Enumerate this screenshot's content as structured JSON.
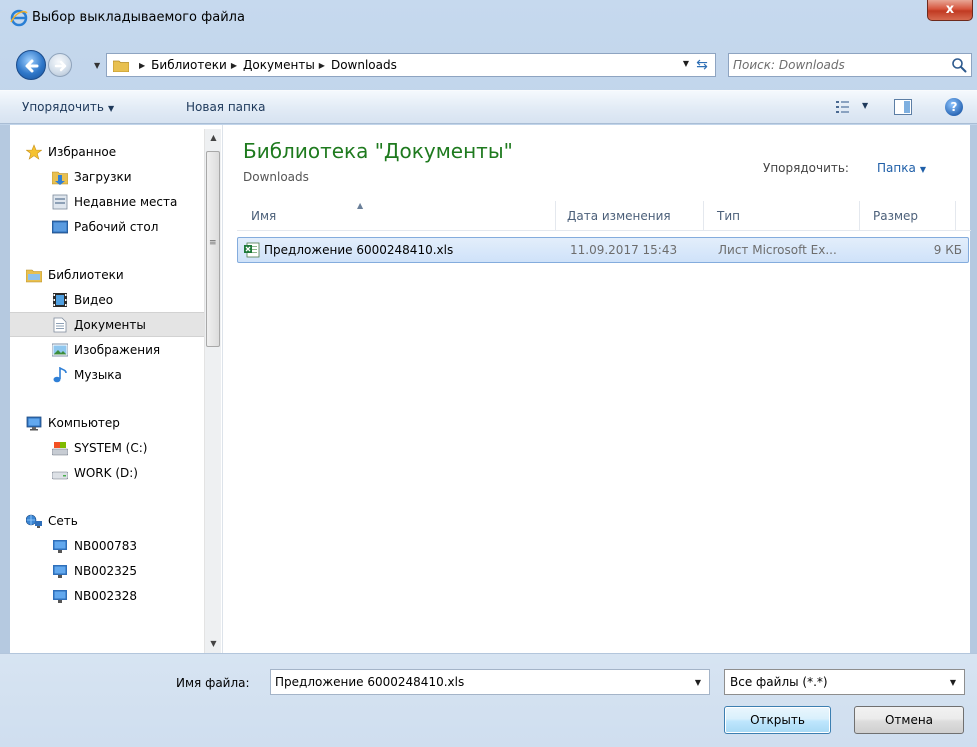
{
  "window": {
    "title": "Выбор выкладываемого файла",
    "close_label": "x"
  },
  "address": {
    "segments": [
      "Библиотеки",
      "Документы",
      "Downloads"
    ],
    "search_placeholder": "Поиск: Downloads"
  },
  "toolbar": {
    "organize_label": "Упорядочить",
    "new_folder_label": "Новая папка",
    "help_label": "?"
  },
  "nav": {
    "favorites": {
      "label": "Избранное",
      "items": [
        "Загрузки",
        "Недавние места",
        "Рабочий стол"
      ]
    },
    "libraries": {
      "label": "Библиотеки",
      "items": [
        "Видео",
        "Документы",
        "Изображения",
        "Музыка"
      ],
      "selected": "Документы"
    },
    "computer": {
      "label": "Компьютер",
      "items": [
        "SYSTEM (C:)",
        "WORK (D:)"
      ]
    },
    "network": {
      "label": "Сеть",
      "items": [
        "NB000783",
        "NB002325",
        "NB002328"
      ]
    }
  },
  "main": {
    "library_title": "Библиотека \"Документы\"",
    "library_subtitle": "Downloads",
    "arrange_label": "Упорядочить:",
    "arrange_value": "Папка",
    "columns": [
      "Имя",
      "Дата изменения",
      "Тип",
      "Размер"
    ],
    "files": [
      {
        "name": "Предложение 6000248410.xls",
        "date": "11.09.2017 15:43",
        "type": "Лист Microsoft Ex...",
        "size": "9 КБ"
      }
    ]
  },
  "bottom": {
    "filename_label": "Имя файла:",
    "filename_value": "Предложение 6000248410.xls",
    "filter_value": "Все файлы (*.*)",
    "open_label": "Открыть",
    "cancel_label": "Отмена"
  },
  "colors": {
    "library_title": "#1e7a1e",
    "link_blue": "#1f5fa8",
    "selection_bg": "#cfe2f9",
    "selection_border": "#84acdd"
  },
  "icons": {
    "title": "internet-explorer-icon",
    "back": "back-arrow-icon",
    "forward": "forward-arrow-icon",
    "search": "search-icon",
    "favorites": "star-icon",
    "downloads": "downloads-folder-icon",
    "recent": "recent-places-icon",
    "desktop": "desktop-icon",
    "libraries": "libraries-icon",
    "video": "video-icon",
    "documents": "documents-icon",
    "pictures": "pictures-icon",
    "music": "music-icon",
    "computer": "computer-icon",
    "drive_c": "system-drive-icon",
    "drive_d": "drive-icon",
    "network": "network-icon",
    "network_pc": "network-computer-icon",
    "xls": "excel-file-icon"
  }
}
